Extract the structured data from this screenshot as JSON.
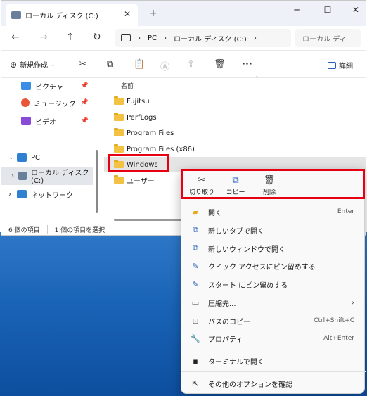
{
  "window": {
    "tab_title": "ローカル ディスク (C:)",
    "tab_close": "✕",
    "new_tab": "+",
    "min": "─",
    "max": "☐",
    "close": "✕"
  },
  "nav": {
    "back": "←",
    "forward": "→",
    "up": "↑",
    "refresh": "↻",
    "breadcrumb": [
      "PC",
      "ローカル ディスク (C:)"
    ],
    "sep": "›",
    "search_placeholder": "ローカル ディ"
  },
  "toolbar": {
    "new_label": "新規作成",
    "view_label": "詳細",
    "more": "···"
  },
  "sidebar": {
    "items": [
      {
        "label": "ピクチャ",
        "icon": "pictures-icon",
        "color": "#3a8ee6",
        "pinned": true
      },
      {
        "label": "ミュージック",
        "icon": "music-icon",
        "color": "#e8553a",
        "pinned": true
      },
      {
        "label": "ビデオ",
        "icon": "videos-icon",
        "color": "#8a4ad8",
        "pinned": true
      },
      {
        "label": "PC",
        "icon": "pc-icon",
        "color": "#2f80d0",
        "expanded": true
      },
      {
        "label": "ローカル ディスク (C:)",
        "icon": "drive-icon",
        "color": "#6a7f99",
        "selected": true
      },
      {
        "label": "ネットワーク",
        "icon": "network-icon",
        "color": "#2f80d0"
      }
    ],
    "pin_glyph": "📌"
  },
  "content": {
    "column_name": "名前",
    "files": [
      "Fujitsu",
      "PerfLogs",
      "Program Files",
      "Program Files (x86)",
      "Windows",
      "ユーザー"
    ]
  },
  "status": {
    "count": "6 個の項目",
    "selected": "1 個の項目を選択"
  },
  "context_menu": {
    "quick": [
      {
        "label": "切り取り",
        "glyph": "✂"
      },
      {
        "label": "コピー",
        "glyph": "⧉"
      },
      {
        "label": "削除",
        "glyph": "🗑"
      }
    ],
    "items": [
      {
        "label": "開く",
        "shortcut": "Enter",
        "icon": "open-folder-icon",
        "glyph": "▰"
      },
      {
        "label": "新しいタブで開く",
        "shortcut": "",
        "icon": "new-tab-icon",
        "glyph": "⧉"
      },
      {
        "label": "新しいウィンドウで開く",
        "shortcut": "",
        "icon": "new-window-icon",
        "glyph": "⧉"
      },
      {
        "label": "クイック アクセスにピン留めする",
        "shortcut": "",
        "icon": "pin-icon",
        "glyph": "✎"
      },
      {
        "label": "スタート にピン留めする",
        "shortcut": "",
        "icon": "pin-start-icon",
        "glyph": "✎"
      },
      {
        "label": "圧縮先...",
        "shortcut": "›",
        "icon": "compress-icon",
        "glyph": "▭"
      },
      {
        "label": "パスのコピー",
        "shortcut": "Ctrl+Shift+C",
        "icon": "copy-path-icon",
        "glyph": "⊡"
      },
      {
        "label": "プロパティ",
        "shortcut": "Alt+Enter",
        "icon": "properties-icon",
        "glyph": "🔧"
      },
      {
        "label": "ターミナルで開く",
        "shortcut": "",
        "icon": "terminal-icon",
        "glyph": "▪"
      },
      {
        "label": "その他のオプションを確認",
        "shortcut": "",
        "icon": "more-options-icon",
        "glyph": "⇱"
      }
    ]
  }
}
